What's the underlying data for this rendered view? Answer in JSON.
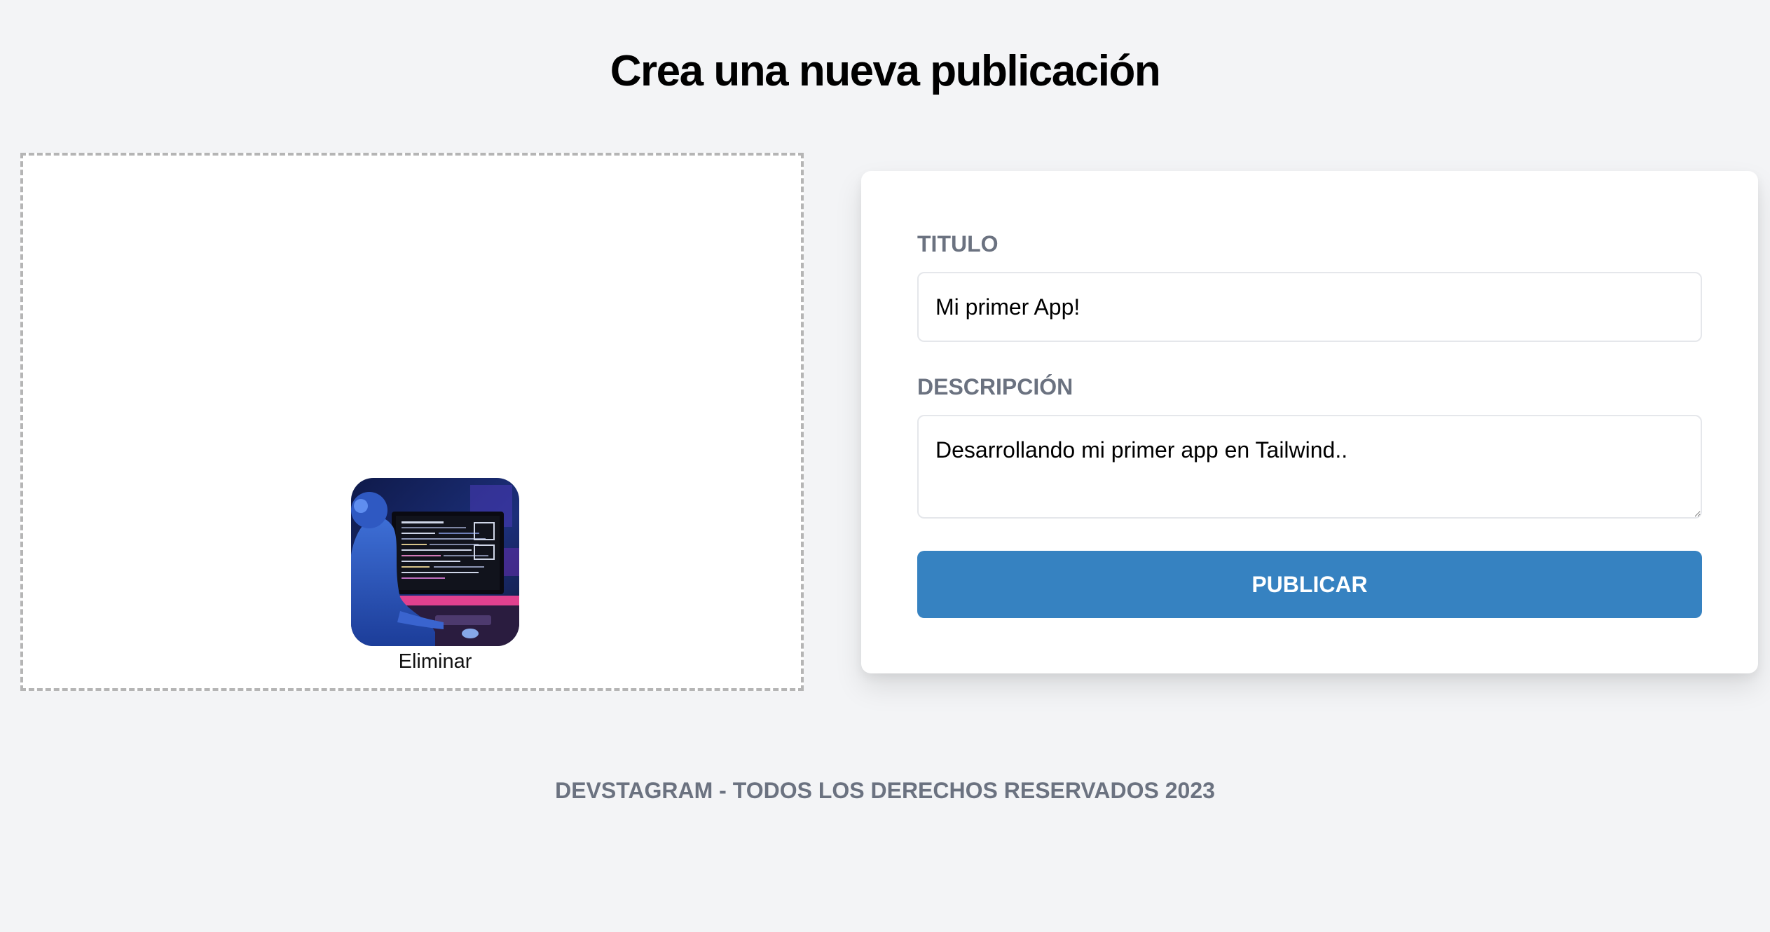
{
  "header": {
    "title": "Crea una nueva publicación"
  },
  "dropzone": {
    "remove_label": "Eliminar"
  },
  "form": {
    "title_label": "Titulo",
    "title_value": "Mi primer App!",
    "description_label": "Descripción",
    "description_value": "Desarrollando mi primer app en Tailwind..",
    "submit_label": "Publicar"
  },
  "footer": {
    "text": "DEVSTAGRAM - TODOS LOS DERECHOS RESERVADOS 2023"
  },
  "colors": {
    "page_background": "#f3f4f6",
    "accent_button": "#3682c1",
    "label_text": "#6b7280"
  }
}
